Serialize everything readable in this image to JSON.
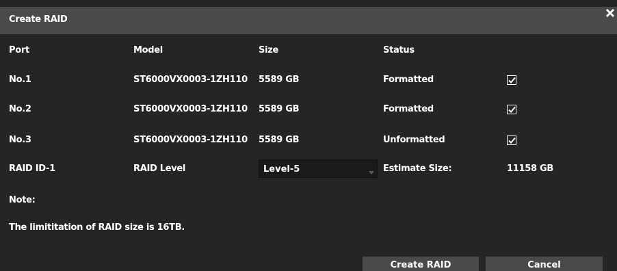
{
  "dialog": {
    "title": "Create RAID"
  },
  "columns": [
    "Port",
    "Model",
    "Size",
    "Status"
  ],
  "disks": [
    {
      "port": "No.1",
      "model": "ST6000VX0003-1ZH110",
      "size": "5589 GB",
      "status": "Formatted",
      "checked": true
    },
    {
      "port": "No.2",
      "model": "ST6000VX0003-1ZH110",
      "size": "5589 GB",
      "status": "Formatted",
      "checked": true
    },
    {
      "port": "No.3",
      "model": "ST6000VX0003-1ZH110",
      "size": "5589 GB",
      "status": "Unformatted",
      "checked": true
    }
  ],
  "raid": {
    "id_label": "RAID ID-1",
    "level_label": "RAID Level",
    "level_value": "Level-5",
    "estimate_label": "Estimate Size:",
    "estimate_value": "11158 GB"
  },
  "note": {
    "label": "Note:",
    "text": "The limititation of RAID size is 16TB."
  },
  "buttons": {
    "create": "Create RAID",
    "cancel": "Cancel"
  },
  "colors": {
    "background": "#252525",
    "titlebar": "#4a4a4a",
    "button": "#4a4a4a",
    "text": "#ffffff"
  },
  "icons": {
    "close": "close-x-icon",
    "checkbox": "checkmark-icon",
    "dropdown": "dropdown-arrow-icon"
  }
}
